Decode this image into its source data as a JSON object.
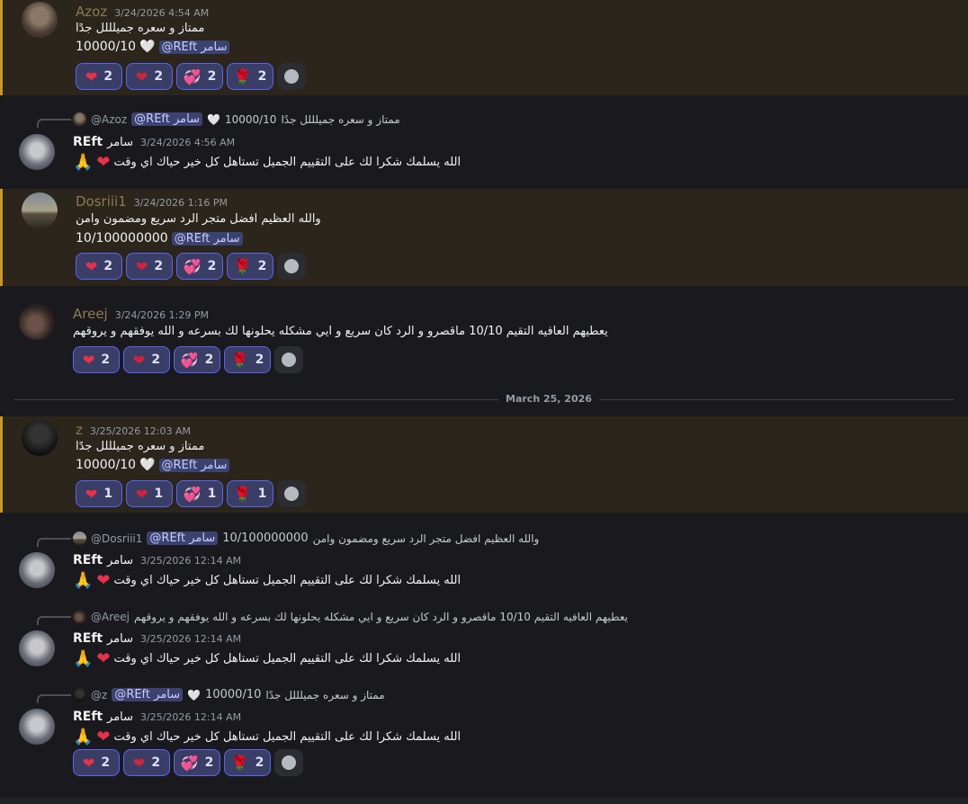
{
  "date_divider": "March 25, 2026",
  "mention": "@REft سامر",
  "m1": {
    "name": "Azoz",
    "time": "3/24/2026 4:54 AM",
    "text1": "ممتاز و سعره جميلللل جدًا",
    "score": "10000/10",
    "reactions": [
      "2",
      "2",
      "2",
      "2"
    ]
  },
  "m2": {
    "reply_name": "@Azoz",
    "reply_text": "ممتاز و سعره جميلللل جدًا",
    "reply_score": "10000/10",
    "name": "REft",
    "name_ar": "سامر",
    "time": "3/24/2026 4:56 AM",
    "text": "الله يسلمك شكرا لك على التقييم الجميل تستاهل كل خير حياك اي وقت"
  },
  "m3": {
    "name": "Dosriii1",
    "time": "3/24/2026 1:16 PM",
    "text1": "والله العظيم افضل متجر الرد سريع ومضمون  وامن",
    "score": "10/100000000",
    "reactions": [
      "2",
      "2",
      "2",
      "2"
    ]
  },
  "m4": {
    "name": "Areej",
    "time": "3/24/2026 1:29 PM",
    "text1": "يعطيهم العافيه التقيم 10/10 ماقصرو و الرد كان سريع و ايي مشكله يحلونها لك بسرعه و الله يوفقهم و يروقهم",
    "reactions": [
      "2",
      "2",
      "2",
      "2"
    ]
  },
  "m5": {
    "name": "z",
    "time": "3/25/2026 12:03 AM",
    "text1": "ممتاز و سعره جميلللل جدًا",
    "score": "10000/10",
    "reactions": [
      "1",
      "1",
      "1",
      "1"
    ]
  },
  "m6": {
    "reply_name": "@Dosriii1",
    "reply_text": "والله العظيم افضل متجر الرد سريع ومضمون  وامن",
    "reply_score": "10/100000000",
    "name": "REft",
    "name_ar": "سامر",
    "time": "3/25/2026 12:14 AM",
    "text": "الله يسلمك شكرا لك على التقييم الجميل تستاهل كل خير حياك اي وقت"
  },
  "m7": {
    "reply_name": "@Areej",
    "reply_text": "يعطيهم العافيه التقيم 10/10 ماقصرو و الرد كان سريع و ايي مشكله يحلونها لك بسرعه و الله يوفقهم و يروقهم",
    "name": "REft",
    "name_ar": "سامر",
    "time": "3/25/2026 12:14 AM",
    "text": "الله يسلمك شكرا لك على التقييم الجميل تستاهل كل خير حياك اي وقت"
  },
  "m8": {
    "reply_name": "@z",
    "reply_text": "ممتاز و سعره جميلللل جدًا",
    "reply_score": "10000/10",
    "name": "REft",
    "name_ar": "سامر",
    "time": "3/25/2026 12:14 AM",
    "text": "الله يسلمك شكرا لك على التقييم الجميل تستاهل كل خير حياك اي وقت",
    "reactions": [
      "2",
      "2",
      "2",
      "2"
    ]
  },
  "emoji": {
    "heart": "❤️",
    "red_heart": "❤",
    "hearts_double": "💞",
    "rose": "🌹",
    "white_heart": "🤍",
    "pray": "🙏"
  },
  "colors": {
    "highlight_bg": "#2b251b",
    "highlight_border": "#c99628",
    "reaction_border": "#5865f2",
    "reaction_bg": "#3a3e66"
  }
}
